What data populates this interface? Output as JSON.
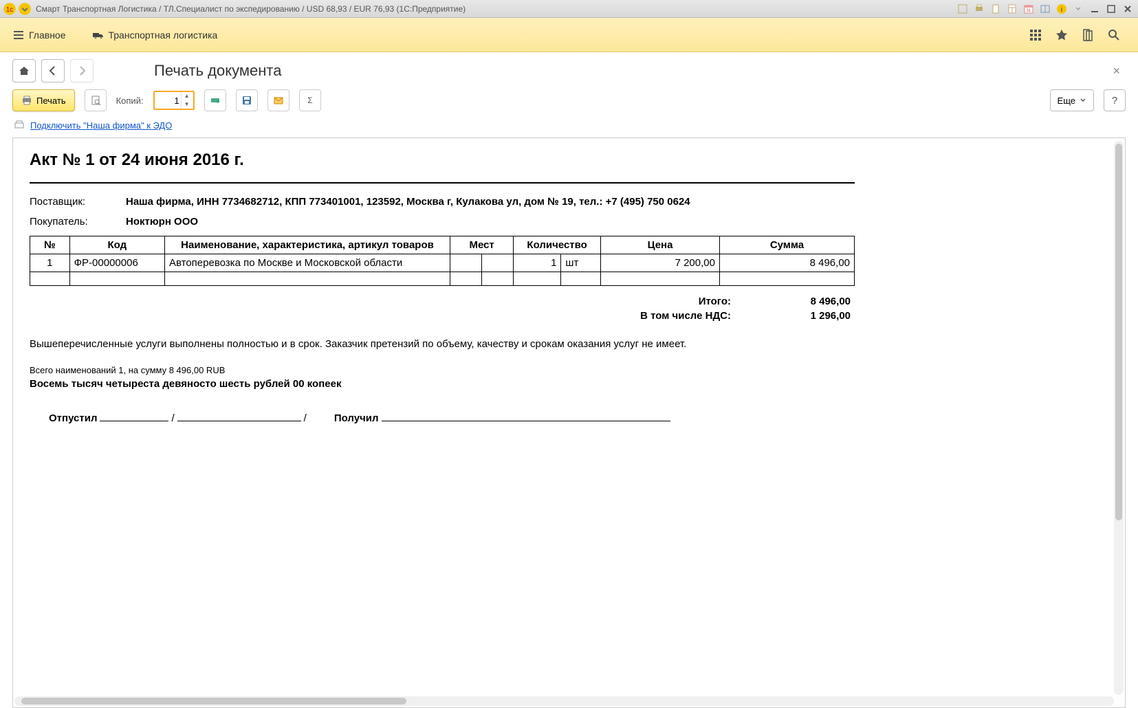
{
  "titlebar": {
    "title": "Смарт Транспортная Логистика / ТЛ.Специалист по экспедированию / USD 68,93 / EUR 76,93  (1С:Предприятие)"
  },
  "navbar": {
    "home": "Главное",
    "logistics": "Транспортная логистика"
  },
  "page": {
    "title": "Печать документа",
    "close": "×"
  },
  "print_toolbar": {
    "print_label": "Печать",
    "copies_label": "Копий:",
    "copies_value": "1",
    "more_label": "Еще",
    "help_label": "?"
  },
  "edo": {
    "link": "Подключить \"Наша фирма\" к ЭДО"
  },
  "document": {
    "heading": "Акт № 1 от 24 июня 2016 г.",
    "supplier_label": "Поставщик:",
    "supplier_value": "Наша фирма,  ИНН 7734682712,  КПП 773401001,  123592, Москва г, Кулакова ул, дом № 19,  тел.: +7 (495) 750 0624",
    "buyer_label": "Покупатель:",
    "buyer_value": "Ноктюрн ООО",
    "table": {
      "headers": {
        "num": "№",
        "code": "Код",
        "name": "Наименование, характеристика, артикул товаров",
        "mest": "Мест",
        "qty": "Количество",
        "price": "Цена",
        "sum": "Сумма"
      },
      "rows": [
        {
          "num": "1",
          "code": "ФР-00000006",
          "name": "Автоперевозка по Москве и Московской области",
          "mest": "",
          "qty": "1",
          "unit": "шт",
          "price": "7 200,00",
          "sum": "8 496,00"
        }
      ]
    },
    "totals": {
      "itogo_label": "Итого:",
      "itogo_value": "8 496,00",
      "nds_label": "В том числе НДС:",
      "nds_value": "1 296,00"
    },
    "disclaimer": "Вышеперечисленные услуги выполнены полностью и в срок. Заказчик претензий по объему, качеству и срокам оказания услуг не имеет.",
    "summary": "Всего наименований 1, на сумму 8 496,00 RUB",
    "amount_words": "Восемь тысяч четыреста девяносто шесть рублей 00 копеек",
    "sign_release": "Отпустил",
    "sign_receive": "Получил",
    "slash": "/"
  }
}
